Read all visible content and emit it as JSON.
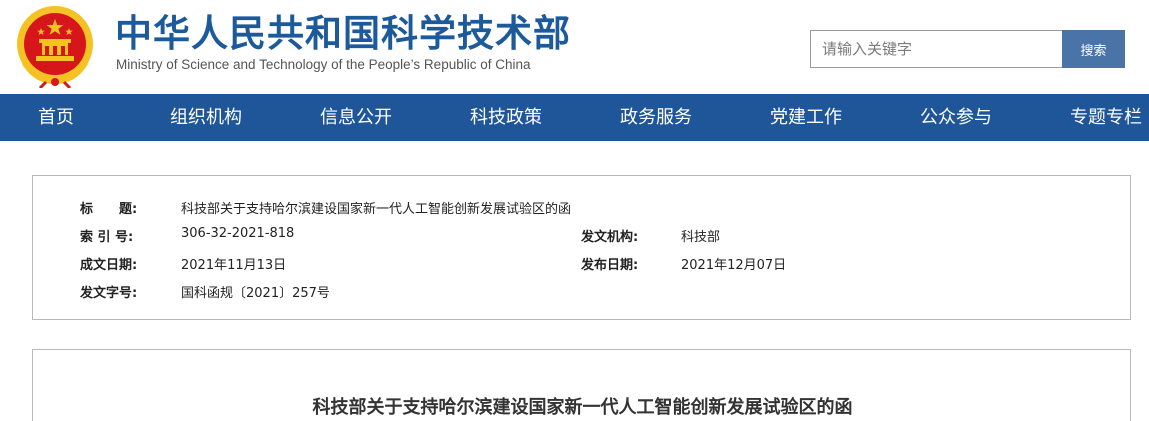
{
  "header": {
    "title": "中华人民共和国科学技术部",
    "subtitle": "Ministry of Science and Technology of the People’s Republic of China",
    "emblem_icon": "national-emblem-icon"
  },
  "search": {
    "placeholder": "请输入关键字",
    "button_label": "搜索"
  },
  "nav": {
    "items": [
      {
        "label": "首页"
      },
      {
        "label": "组织机构"
      },
      {
        "label": "信息公开"
      },
      {
        "label": "科技政策"
      },
      {
        "label": "政务服务"
      },
      {
        "label": "党建工作"
      },
      {
        "label": "公众参与"
      },
      {
        "label": "专题专栏"
      }
    ]
  },
  "meta": {
    "title_label": "标　　题:",
    "title_value": "科技部关于支持哈尔滨建设国家新一代人工智能创新发展试验区的函",
    "index_label": "索 引 号:",
    "index_value": "306-32-2021-818",
    "issuer_label": "发文机构:",
    "issuer_value": "科技部",
    "created_label": "成文日期:",
    "created_value": "2021年11月13日",
    "published_label": "发布日期:",
    "published_value": "2021年12月07日",
    "doc_no_label": "发文字号:",
    "doc_no_value": "国科函规〔2021〕257号"
  },
  "article": {
    "title": "科技部关于支持哈尔滨建设国家新一代人工智能创新发展试验区的函"
  },
  "colors": {
    "brand_blue": "#1d5a9c",
    "nav_bg": "#1f5699",
    "search_button": "#4a74a7",
    "emblem_red": "#d7161b",
    "emblem_gold": "#f4c223"
  }
}
